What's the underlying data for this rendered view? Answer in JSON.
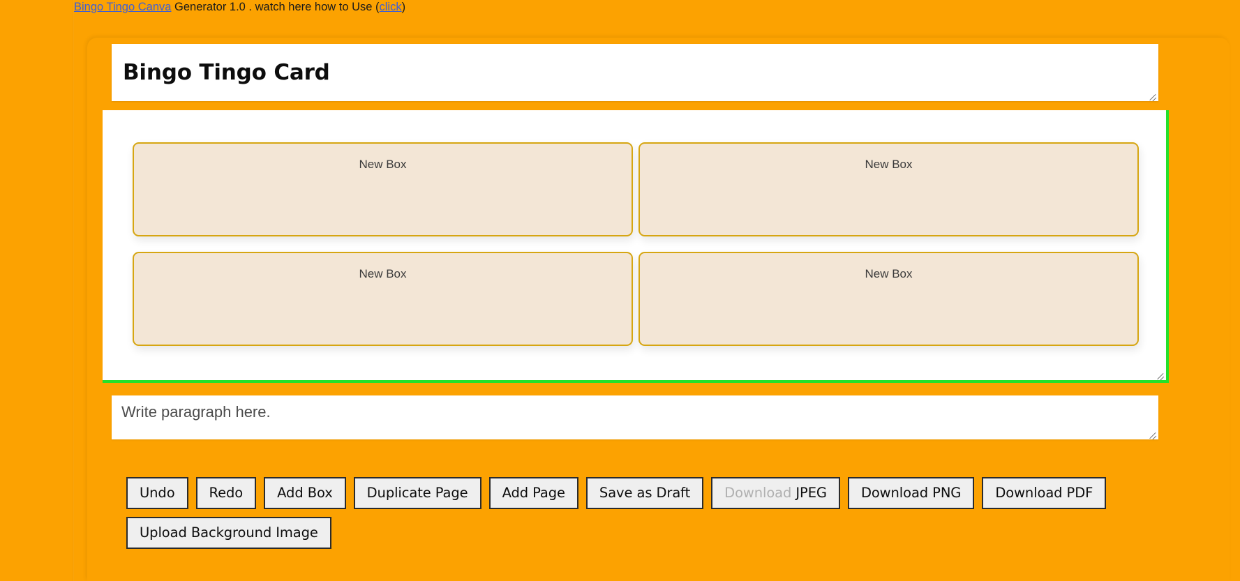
{
  "header": {
    "brand_link": "Bingo Tingo Canva",
    "text_after_brand": "Generator 1.0 . watch here how to Use (",
    "help_link": "click",
    "text_close": ")"
  },
  "title_box": {
    "value": "Bingo Tingo Card",
    "resize_handle": "resize-handle-icon"
  },
  "canvas": {
    "boxes": [
      {
        "label": "New Box"
      },
      {
        "label": "New Box"
      },
      {
        "label": "New Box"
      },
      {
        "label": "New Box"
      }
    ],
    "resize_handle": "resize-handle-icon"
  },
  "paragraph": {
    "placeholder": "Write paragraph here.",
    "value": "Write paragraph here.",
    "resize_handle": "resize-handle-icon"
  },
  "toolbar": {
    "row1": [
      {
        "label": "Undo",
        "name": "undo-button"
      },
      {
        "label": "Redo",
        "name": "redo-button"
      },
      {
        "label": "Add Box",
        "name": "add-box-button"
      },
      {
        "label": "Duplicate Page",
        "name": "duplicate-page-button"
      },
      {
        "label": "Add Page",
        "name": "add-page-button"
      },
      {
        "label": "Save as Draft",
        "name": "save-as-draft-button"
      }
    ],
    "download_jpeg": {
      "dim_part": "Download ",
      "bold_part": "JPEG"
    },
    "download_png": {
      "label": "Download PNG"
    },
    "download_pdf": {
      "label": "Download PDF"
    },
    "row2": [
      {
        "label": "Upload Background Image",
        "name": "upload-background-image-button"
      }
    ]
  },
  "colors": {
    "background_orange": "#fca201",
    "canvas_selection_green": "#25e02a",
    "box_fill": "#f3e6d6",
    "box_border": "#d6a612",
    "button_fill": "#efefef",
    "button_border": "#2b2b2b",
    "link_blue": "#3e5fd6"
  }
}
